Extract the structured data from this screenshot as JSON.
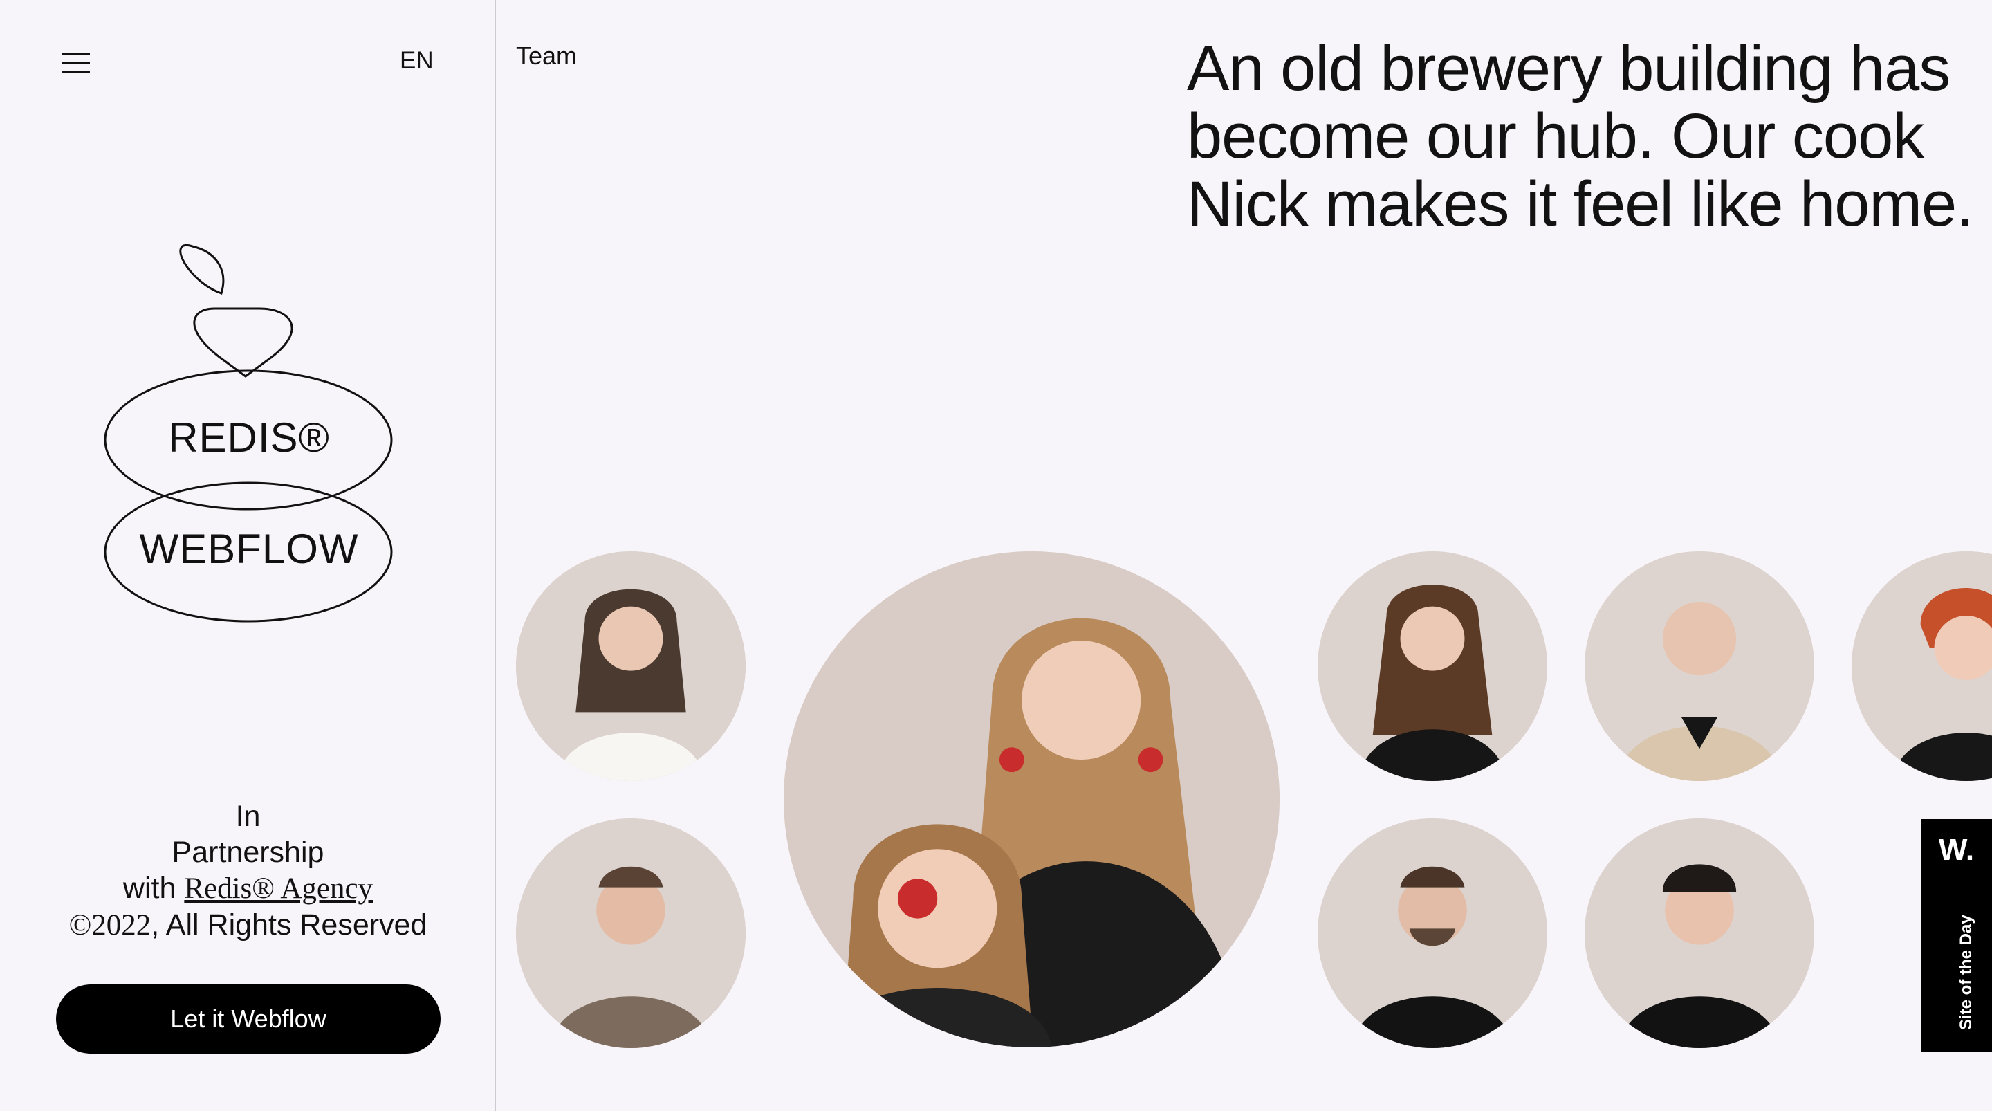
{
  "sidebar": {
    "language": "EN",
    "logo": {
      "top_text": "REDIS®",
      "bottom_text": "WEBFLOW"
    },
    "credit": {
      "line1": "In",
      "line2": "Partnership",
      "with": "with",
      "agency_link": "Redis® Agency",
      "copyright_symbol": "©2022",
      "copyright_rest": ", All Rights Reserved"
    },
    "cta_label": "Let it Webflow"
  },
  "main": {
    "section_label": "Team",
    "headline": "An old brewery building has become our hub. Our cook Nick makes it feel like home."
  },
  "badge": {
    "logo": "W.",
    "text": "Site of the Day"
  },
  "icons": {
    "menu": "hamburger-menu-icon"
  },
  "colors": {
    "background": "#f8f5fa",
    "text": "#111111",
    "button": "#000000",
    "photo_bg": "#dcd2cc"
  }
}
